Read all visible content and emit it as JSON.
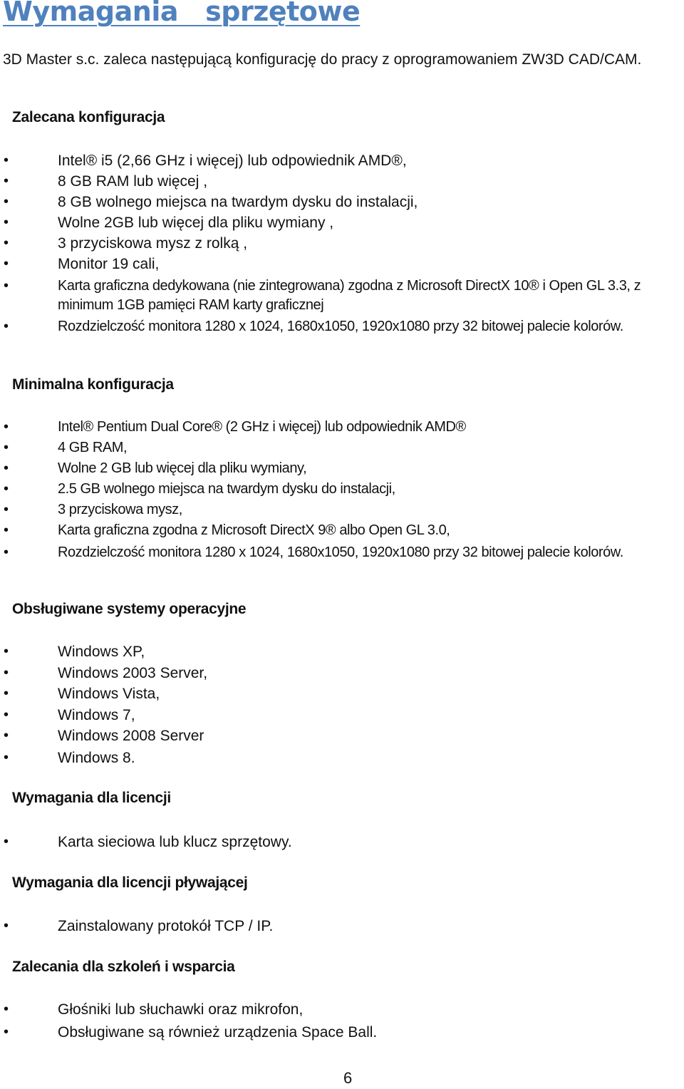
{
  "document": {
    "title": "Wymagania   sprzętowe",
    "intro": "3D Master s.c. zaleca następującą konfigurację do pracy z oprogramowaniem ZW3D CAD/CAM.",
    "bullet_glyph": "•",
    "page_number": "6",
    "title_color": "#4f81bd",
    "sections": [
      {
        "heading": "Zalecana konfiguracja",
        "items": [
          "Intel® i5 (2,66 GHz i więcej) lub odpowiednik AMD®,",
          "8 GB RAM lub więcej ,",
          "8 GB wolnego miejsca na twardym dysku do instalacji,",
          "Wolne 2GB lub więcej dla pliku wymiany ,",
          "3 przyciskowa mysz z rolką ,",
          "Monitor 19 cali,",
          "Karta graficzna dedykowana (nie zintegrowana) zgodna z Microsoft DirectX 10® i Open GL 3.3, z minimum 1GB pamięci RAM karty graficznej",
          "Rozdzielczość monitora 1280 x 1024, 1680x1050, 1920x1080 przy 32 bitowej palecie kolorów."
        ]
      },
      {
        "heading": "Minimalna konfiguracja",
        "items": [
          "Intel®  Pentium Dual Core® (2 GHz i więcej) lub odpowiednik AMD®",
          "4 GB RAM,",
          "Wolne 2 GB lub więcej dla pliku wymiany,",
          "2.5 GB wolnego miejsca na twardym dysku do instalacji,",
          "3 przyciskowa mysz,",
          "Karta graficzna zgodna z Microsoft DirectX 9® albo Open GL 3.0,",
          "Rozdzielczość monitora 1280 x 1024, 1680x1050, 1920x1080 przy 32 bitowej palecie kolorów."
        ]
      },
      {
        "heading": "Obsługiwane systemy operacyjne",
        "items": [
          "Windows XP,",
          "Windows 2003 Server,",
          "Windows Vista,",
          "Windows 7,",
          "Windows 2008 Server",
          "Windows 8."
        ]
      },
      {
        "heading": "Wymagania dla licencji",
        "items": [
          "Karta sieciowa lub klucz sprzętowy."
        ]
      },
      {
        "heading": "Wymagania dla licencji pływającej",
        "items": [
          "Zainstalowany protokół TCP / IP."
        ]
      },
      {
        "heading": "Zalecania dla szkoleń i wsparcia",
        "items": [
          "Głośniki lub słuchawki oraz mikrofon,",
          "Obsługiwane są również urządzenia Space Ball."
        ]
      }
    ]
  }
}
